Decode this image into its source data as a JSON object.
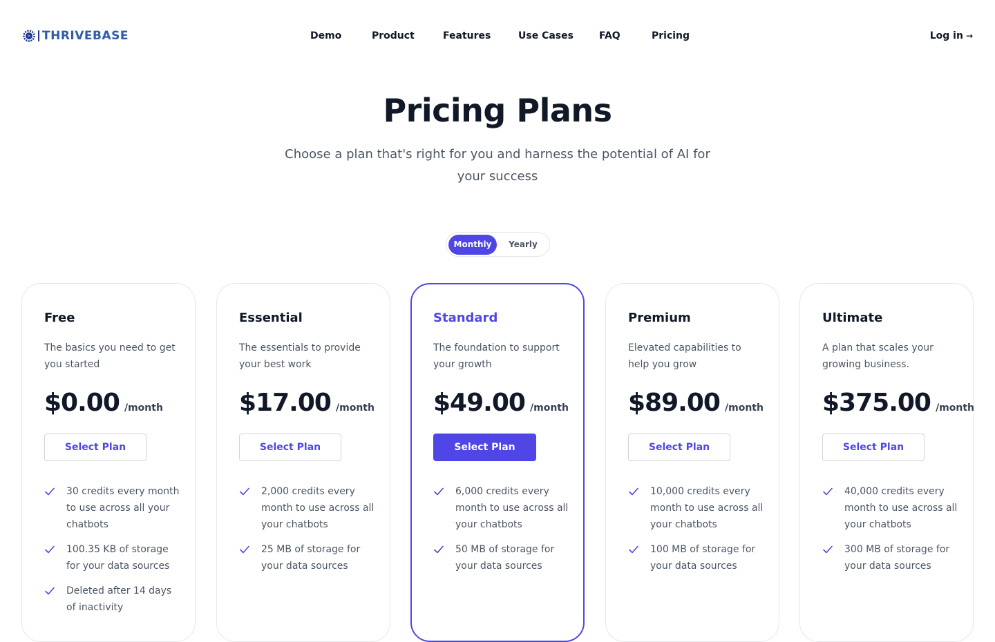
{
  "brand": {
    "name": "THRIVEBASE",
    "accent": "#4f46e5",
    "logo_icon": "gear-brain-icon"
  },
  "nav": [
    {
      "label": "Demo"
    },
    {
      "label": "Product"
    },
    {
      "label": "Features"
    },
    {
      "label": "Use Cases"
    },
    {
      "label": "FAQ"
    },
    {
      "label": "Pricing"
    }
  ],
  "login": {
    "label": "Log in",
    "arrow": "→"
  },
  "hero": {
    "title": "Pricing Plans",
    "subtitle": "Choose a plan that's right for you and harness the potential of AI for your success"
  },
  "billing_toggle": {
    "monthly": "Monthly",
    "yearly": "Yearly",
    "selected": "Monthly"
  },
  "plans": [
    {
      "name": "Free",
      "description": "The basics you need to get you started",
      "price": "$0.00",
      "period": "/month",
      "button": "Select Plan",
      "features": [
        "30 credits every month to use across all your chatbots",
        "100.35 KB of storage for your data sources",
        "Deleted after 14 days of inactivity"
      ]
    },
    {
      "name": "Essential",
      "description": "The essentials to provide your best work",
      "price": "$17.00",
      "period": "/month",
      "button": "Select Plan",
      "features": [
        "2,000 credits every month to use across all your chatbots",
        "25 MB of storage for your data sources"
      ]
    },
    {
      "name": "Standard",
      "description": "The foundation to support your growth",
      "price": "$49.00",
      "period": "/month",
      "button": "Select Plan",
      "featured": true,
      "features": [
        "6,000 credits every month to use across all your chatbots",
        "50 MB of storage for your data sources"
      ]
    },
    {
      "name": "Premium",
      "description": "Elevated capabilities to help you grow",
      "price": "$89.00",
      "period": "/month",
      "button": "Select Plan",
      "features": [
        "10,000 credits every month to use across all your chatbots",
        "100 MB of storage for your data sources"
      ]
    },
    {
      "name": "Ultimate",
      "description": "A plan that scales your growing business.",
      "price": "$375.00",
      "period": "/month",
      "button": "Select Plan",
      "features": [
        "40,000 credits every month to use across all your chatbots",
        "300 MB of storage for your data sources"
      ]
    }
  ]
}
